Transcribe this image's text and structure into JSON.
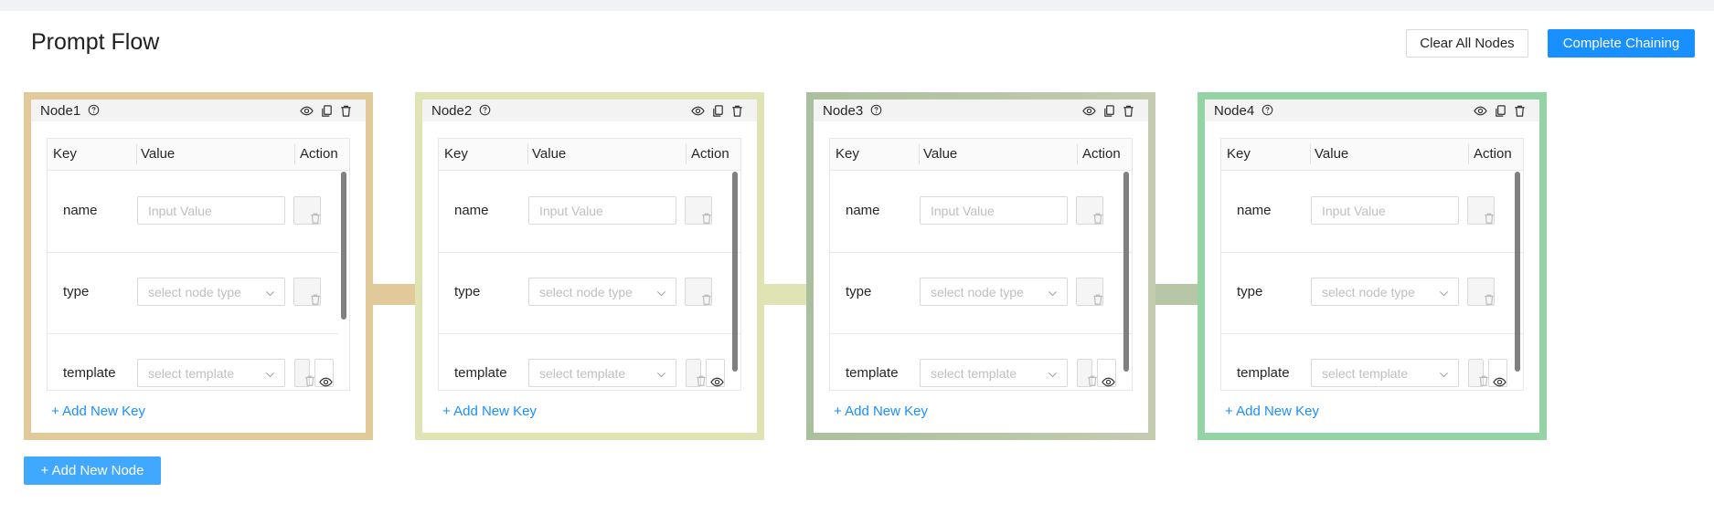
{
  "page": {
    "title": "Prompt Flow",
    "clear_label": "Clear All Nodes",
    "complete_label": "Complete Chaining",
    "add_node_label": "+ Add New Node"
  },
  "table": {
    "col_key": "Key",
    "col_value": "Value",
    "col_action": "Action"
  },
  "nodes": [
    {
      "title": "Node1",
      "color": "#e2c99a",
      "rows": [
        {
          "key": "name",
          "placeholder": "Input Value"
        },
        {
          "key": "type",
          "placeholder": "select node type"
        },
        {
          "key": "template",
          "placeholder": "select template"
        }
      ],
      "add_key_label": "+ Add New Key"
    },
    {
      "title": "Node2",
      "color": "#e0e3b4",
      "rows": [
        {
          "key": "name",
          "placeholder": "Input Value"
        },
        {
          "key": "type",
          "placeholder": "select node type"
        },
        {
          "key": "template",
          "placeholder": "select template"
        }
      ],
      "add_key_label": "+ Add New Key"
    },
    {
      "title": "Node3",
      "color": "#b8c6a8",
      "rows": [
        {
          "key": "name",
          "placeholder": "Input Value"
        },
        {
          "key": "type",
          "placeholder": "select node type"
        },
        {
          "key": "template",
          "placeholder": "select template"
        }
      ],
      "add_key_label": "+ Add New Key"
    },
    {
      "title": "Node4",
      "color": "#94d3a4",
      "rows": [
        {
          "key": "name",
          "placeholder": "Input Value"
        },
        {
          "key": "type",
          "placeholder": "select node type"
        },
        {
          "key": "template",
          "placeholder": "select template"
        }
      ],
      "add_key_label": "+ Add New Key"
    }
  ],
  "colors": {
    "primary": "#1890ff",
    "add_node_button": "#40a9ff",
    "connector_1": "#e2c99a",
    "connector_2": "#e0e3b4",
    "connector_3": "#b8c6a8"
  },
  "icons": {
    "help": "question-circle-icon",
    "eye": "eye-icon",
    "copy": "copy-icon",
    "delete": "trash-icon",
    "chevron": "chevron-down-icon"
  }
}
